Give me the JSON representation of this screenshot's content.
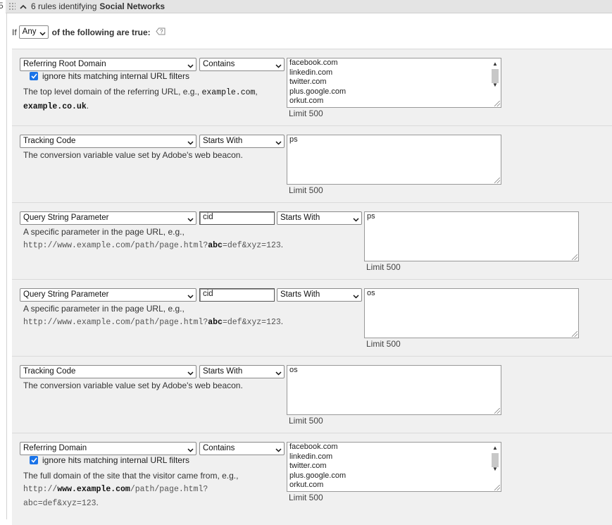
{
  "side_number": "5",
  "header": {
    "count_text": "6 rules identifying",
    "segment_name": "Social Networks"
  },
  "condition": {
    "prefix": "If",
    "operator": "Any",
    "suffix": "of the following are true:"
  },
  "limit_label": "Limit 500",
  "checkbox_label": "ignore hits matching internal URL filters",
  "rules": [
    {
      "dimension": "Referring Root Domain",
      "operator": "Contains",
      "values": [
        "facebook.com",
        "linkedin.com",
        "twitter.com",
        "plus.google.com",
        "orkut.com"
      ],
      "ignore_internal": true,
      "desc_prefix": "The top level domain of the referring URL, e.g.,",
      "desc_code1": "example.com",
      "desc_sep": ",",
      "desc_code2": "example.co.uk",
      "desc_end": "."
    },
    {
      "dimension": "Tracking Code",
      "operator": "Starts With",
      "value": "ps",
      "desc": "The conversion variable value set by Adobe's web beacon."
    },
    {
      "dimension": "Query String Parameter",
      "param": "cid",
      "operator": "Starts With",
      "value": "ps",
      "desc_prefix": "A specific parameter in the page URL, e.g.,",
      "url_a": "http://www.example.com/path/page.html?",
      "url_b": "abc",
      "url_c": "=def&xyz=123",
      "url_end": "."
    },
    {
      "dimension": "Query String Parameter",
      "param": "cid",
      "operator": "Starts With",
      "value": "os",
      "desc_prefix": "A specific parameter in the page URL, e.g.,",
      "url_a": "http://www.example.com/path/page.html?",
      "url_b": "abc",
      "url_c": "=def&xyz=123",
      "url_end": "."
    },
    {
      "dimension": "Tracking Code",
      "operator": "Starts With",
      "value": "os",
      "desc": "The conversion variable value set by Adobe's web beacon."
    },
    {
      "dimension": "Referring Domain",
      "operator": "Contains",
      "values": [
        "facebook.com",
        "linkedin.com",
        "twitter.com",
        "plus.google.com",
        "orkut.com"
      ],
      "ignore_internal": true,
      "desc_prefix": "The full domain of the site that the visitor came from, e.g.,",
      "url_a": "http://",
      "url_b": "www.example.com",
      "url_c": "/path/page.html?",
      "url_d": "abc=def&xyz=123",
      "url_end": "."
    }
  ]
}
